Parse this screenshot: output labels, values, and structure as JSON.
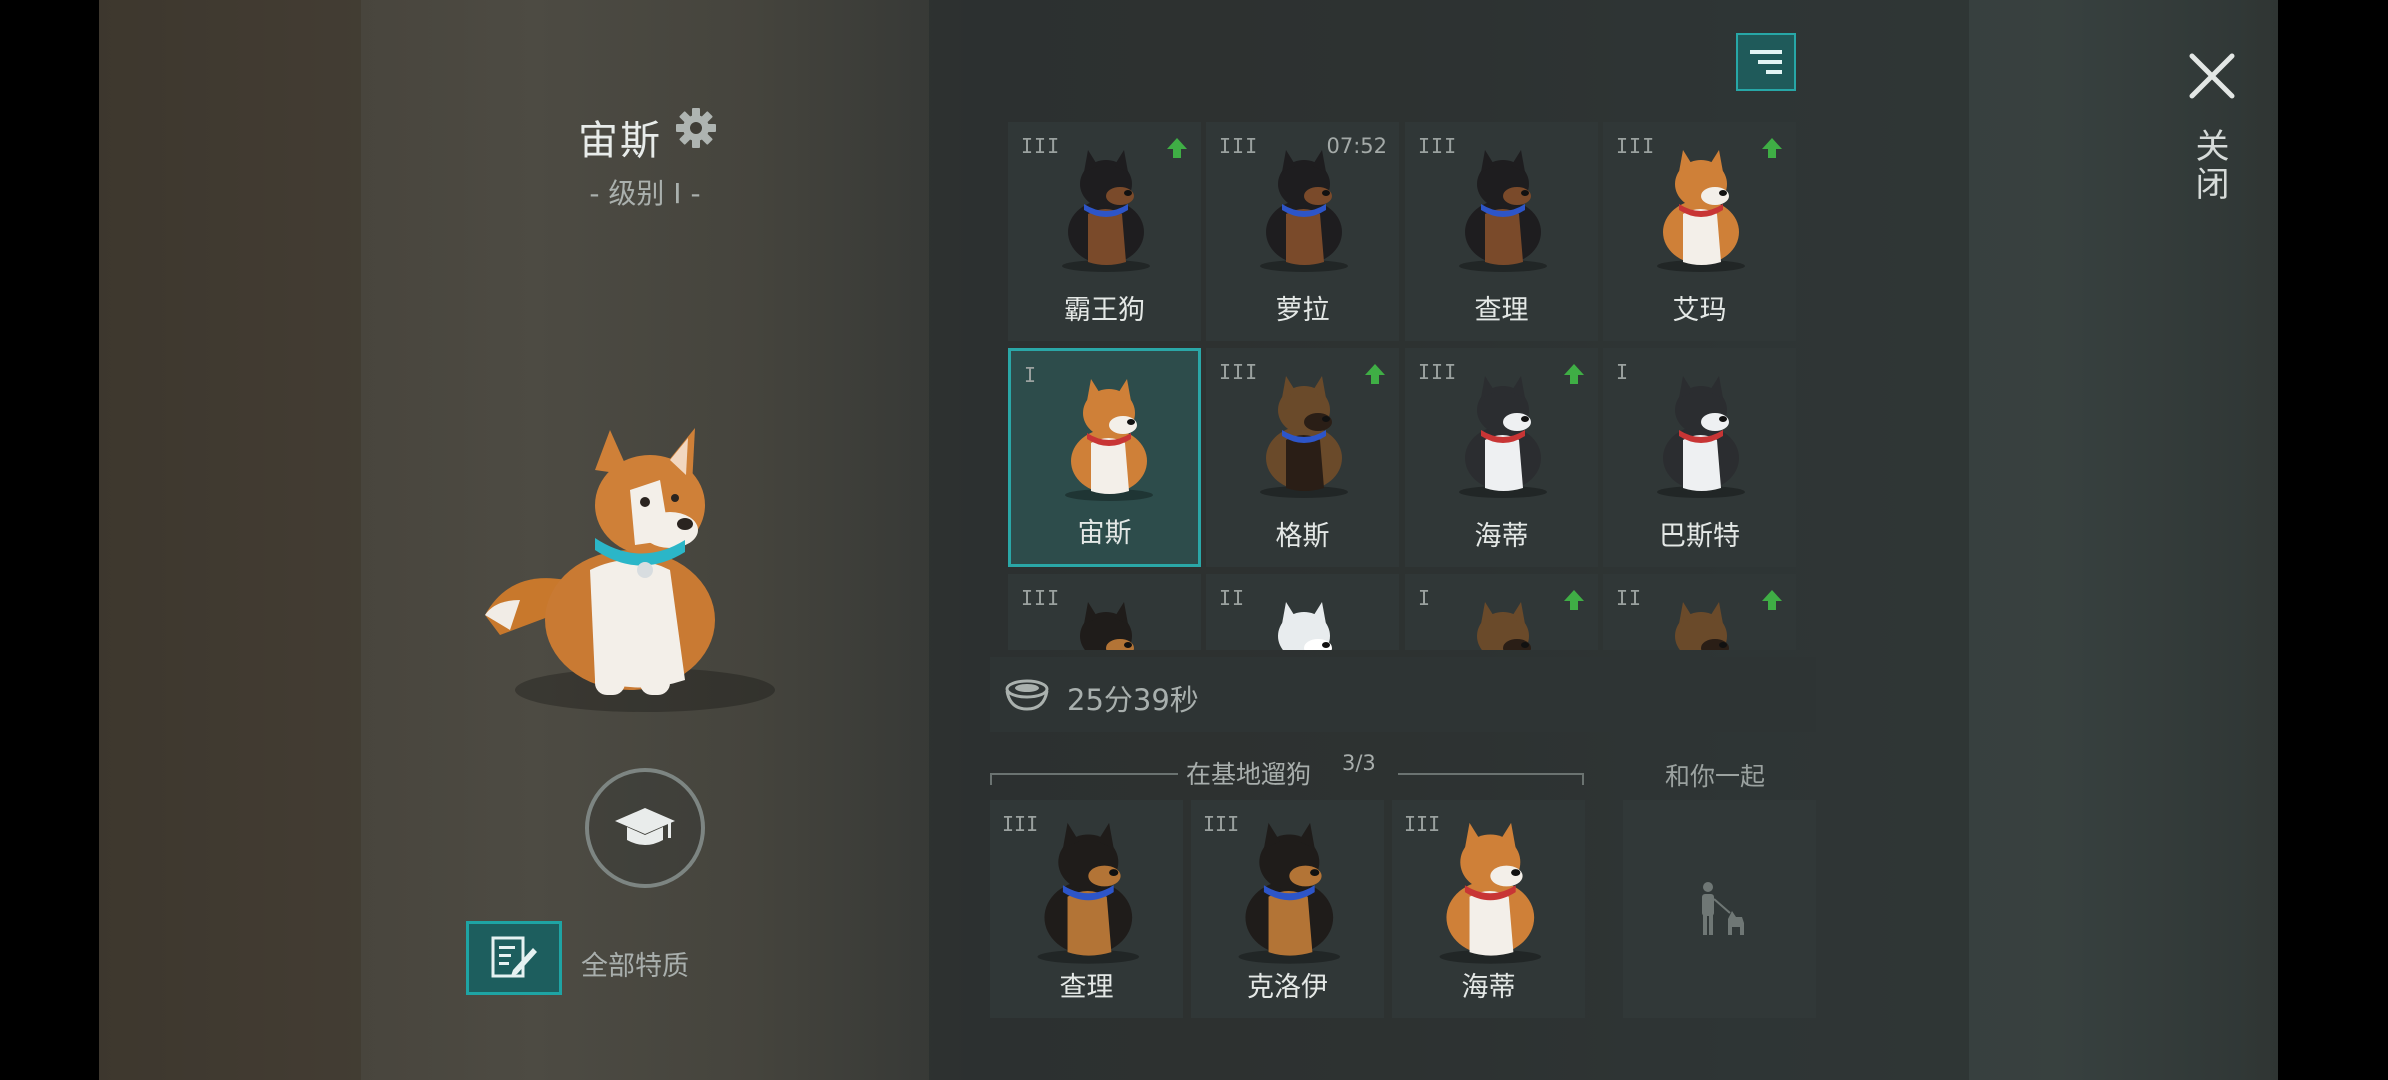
{
  "dog": {
    "name": "宙斯",
    "level_label": "- 级别 I -"
  },
  "traits_label": "全部特质",
  "grid": [
    {
      "name": "霸王狗",
      "rank": "III",
      "upgrade": true,
      "timer": "",
      "breed": "rottweiler",
      "selected": false
    },
    {
      "name": "萝拉",
      "rank": "III",
      "upgrade": false,
      "timer": "07:52",
      "breed": "rottweiler",
      "selected": false
    },
    {
      "name": "查理",
      "rank": "III",
      "upgrade": false,
      "timer": "",
      "breed": "rottweiler",
      "selected": false
    },
    {
      "name": "艾玛",
      "rank": "III",
      "upgrade": true,
      "timer": "",
      "breed": "corgi",
      "selected": false
    },
    {
      "name": "宙斯",
      "rank": "I",
      "upgrade": false,
      "timer": "",
      "breed": "corgi",
      "selected": true
    },
    {
      "name": "格斯",
      "rank": "III",
      "upgrade": true,
      "timer": "",
      "breed": "mastiff",
      "selected": false
    },
    {
      "name": "海蒂",
      "rank": "III",
      "upgrade": true,
      "timer": "",
      "breed": "husky",
      "selected": false
    },
    {
      "name": "巴斯特",
      "rank": "I",
      "upgrade": false,
      "timer": "",
      "breed": "husky",
      "selected": false
    },
    {
      "name": "",
      "rank": "III",
      "upgrade": false,
      "timer": "",
      "breed": "shepherd",
      "selected": false
    },
    {
      "name": "",
      "rank": "II",
      "upgrade": false,
      "timer": "",
      "breed": "white",
      "selected": false
    },
    {
      "name": "",
      "rank": "I",
      "upgrade": true,
      "timer": "",
      "breed": "mastiff",
      "selected": false
    },
    {
      "name": "",
      "rank": "II",
      "upgrade": true,
      "timer": "",
      "breed": "mastiff",
      "selected": false
    }
  ],
  "food_timer": "25分39秒",
  "base": {
    "title": "在基地遛狗",
    "count": "3/3",
    "dogs": [
      {
        "name": "查理",
        "rank": "III",
        "breed": "shepherd"
      },
      {
        "name": "克洛伊",
        "rank": "III",
        "breed": "shepherd"
      },
      {
        "name": "海蒂",
        "rank": "III",
        "breed": "corgi"
      }
    ]
  },
  "with_you_label": "和你一起",
  "close_label": "关闭",
  "colors": {
    "accent": "#2aa7a7",
    "upgrade_arrow": "#3fae45",
    "card_bg": "#303737",
    "selected_bg": "#2d4c4b"
  }
}
